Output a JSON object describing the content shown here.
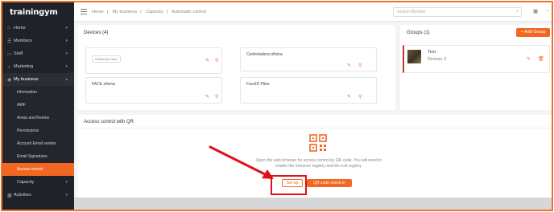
{
  "brand": {
    "name": "trainingym"
  },
  "sidebar": {
    "items": [
      {
        "label": "Home",
        "icon": "home-icon"
      },
      {
        "label": "Members",
        "icon": "members-icon"
      },
      {
        "label": "Staff",
        "icon": "staff-icon"
      },
      {
        "label": "Marketing",
        "icon": "marketing-icon"
      },
      {
        "label": "My business",
        "icon": "location-icon"
      }
    ],
    "sub_items": [
      {
        "label": "Information"
      },
      {
        "label": "AWF"
      },
      {
        "label": "Areas and Rooms"
      },
      {
        "label": "Permissions"
      },
      {
        "label": "Account Email sender"
      },
      {
        "label": "Email Signatures"
      },
      {
        "label": "Access control"
      },
      {
        "label": "Capacity"
      }
    ],
    "activities": {
      "label": "Activities",
      "icon": "calendar-icon"
    }
  },
  "topbar": {
    "breadcrumb": [
      "Home",
      "My business",
      "Capacity",
      "Automatic control"
    ],
    "search_placeholder": "Search Member"
  },
  "devices": {
    "title": "Devices (4)",
    "items": [
      {
        "name": "",
        "tag": "Área de inicio"
      },
      {
        "name": "Controladora oficina",
        "tag": ""
      },
      {
        "name": "FACE oficina",
        "tag": ""
      },
      {
        "name": "FaceID Pltex",
        "tag": ""
      }
    ]
  },
  "groups": {
    "title": "Groups (1)",
    "add_label": "+ Add Group",
    "items": [
      {
        "name": "Test",
        "devices": "Devices: 2"
      }
    ]
  },
  "qr": {
    "title": "Access control with QR",
    "description": "Open the web browser for access control by QR code. You will need to enable the entrance registry and the exit registry.",
    "set_up_label": "Set up",
    "check_in_label": "QR code check-in"
  },
  "colors": {
    "accent": "#f26722",
    "sidebar": "#1f2228",
    "annotation": "#e0101a",
    "frame": "#e8772e"
  }
}
